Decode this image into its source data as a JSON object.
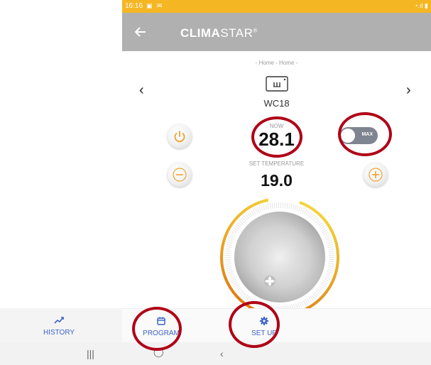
{
  "status_bar": {
    "time": "16:16",
    "left_icons": "▣ ✉",
    "right_icons": "◔.ıl ▮"
  },
  "app_bar": {
    "brand_bold": "CLIMA",
    "brand_light": "STAR",
    "brand_mark": "®"
  },
  "breadcrumb": "- Home - Home -",
  "device": {
    "name": "WC18"
  },
  "nav": {
    "prev": "‹",
    "next": "›"
  },
  "now": {
    "label": "NOW",
    "value": "28.1"
  },
  "toggle": {
    "label": "MAX"
  },
  "set_temperature": {
    "label": "SET TEMPERATURE",
    "value": "19.0"
  },
  "bottom_nav": {
    "items": [
      {
        "label": "HISTORY",
        "icon": "trend-icon"
      },
      {
        "label": "PROGRAM",
        "icon": "calendar-icon"
      },
      {
        "label": "SET UP",
        "icon": "gear-icon"
      }
    ]
  },
  "system_nav": {
    "recent": "|||",
    "home": "◯",
    "back": "‹"
  },
  "colors": {
    "status": "#f5b624",
    "appbar": "#b0b0b0",
    "accent": "#3e63c9",
    "ring_start": "#e07a12",
    "ring_end": "#f3d43a",
    "marker": "#b00016"
  }
}
